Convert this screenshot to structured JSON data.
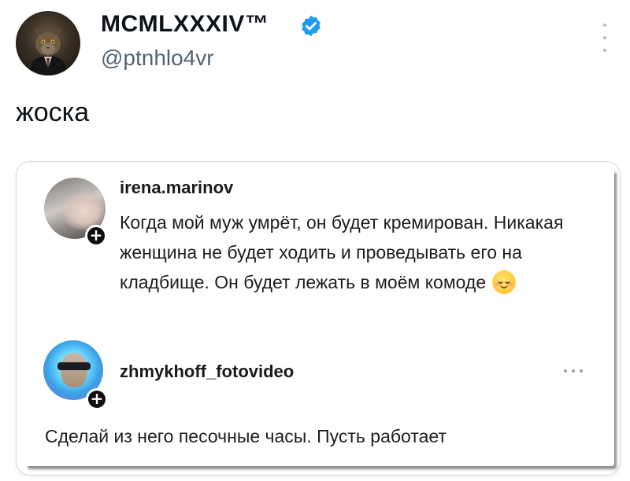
{
  "tweet": {
    "author": {
      "name": "MCMLXXXIV™",
      "handle": "@ptnhlo4vr",
      "verified": true,
      "verified_color": "#1d9bf0"
    },
    "text": "жоска",
    "menu_icon": "more-vertical-icon"
  },
  "embedded": {
    "comments": [
      {
        "username": "irena.marinov",
        "text": "Когда мой муж умрёт, он будет кремирован. Никакая женщина не будет ходить и проведывать его на кладбище. Он будет лежать в моём комоде",
        "emoji": "smiling-face-icon",
        "badge": "+"
      },
      {
        "username": "zhmykhoff_fotovideo",
        "text": "Сделай из него песочные часы. Пусть работает",
        "badge": "+",
        "menu_icon": "more-horizontal-icon"
      }
    ]
  },
  "colors": {
    "text_primary": "#0f1419",
    "text_secondary": "#536471",
    "verified_blue": "#1d9bf0"
  }
}
